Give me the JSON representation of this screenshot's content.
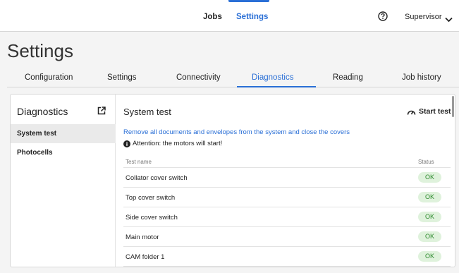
{
  "nav": {
    "jobs": "Jobs",
    "settings": "Settings",
    "user": "Supervisor",
    "help_icon": "help-circle-icon",
    "chevron_icon": "chevron-down-icon"
  },
  "page": {
    "title": "Settings"
  },
  "tabs": [
    {
      "label": "Configuration"
    },
    {
      "label": "Settings"
    },
    {
      "label": "Connectivity"
    },
    {
      "label": "Diagnostics",
      "active": true
    },
    {
      "label": "Reading"
    },
    {
      "label": "Job history"
    }
  ],
  "sidebar": {
    "title": "Diagnostics",
    "popout_icon": "open-external-icon",
    "items": [
      {
        "label": "System test",
        "selected": true
      },
      {
        "label": "Photocells"
      }
    ]
  },
  "content": {
    "title": "System test",
    "start_label": "Start test",
    "instruction": "Remove all documents and envelopes from the system and close the covers",
    "attention": "Attention: the motors will start!",
    "table": {
      "col_name": "Test name",
      "col_status": "Status",
      "rows": [
        {
          "name": "Collator cover switch",
          "status": "OK"
        },
        {
          "name": "Top cover switch",
          "status": "OK"
        },
        {
          "name": "Side cover switch",
          "status": "OK"
        },
        {
          "name": "Main motor",
          "status": "OK"
        },
        {
          "name": "CAM folder 1",
          "status": "OK"
        }
      ]
    }
  },
  "colors": {
    "accent": "#2a6fd6",
    "ok_bg": "#dff2dc",
    "ok_text": "#2e8a2e"
  }
}
